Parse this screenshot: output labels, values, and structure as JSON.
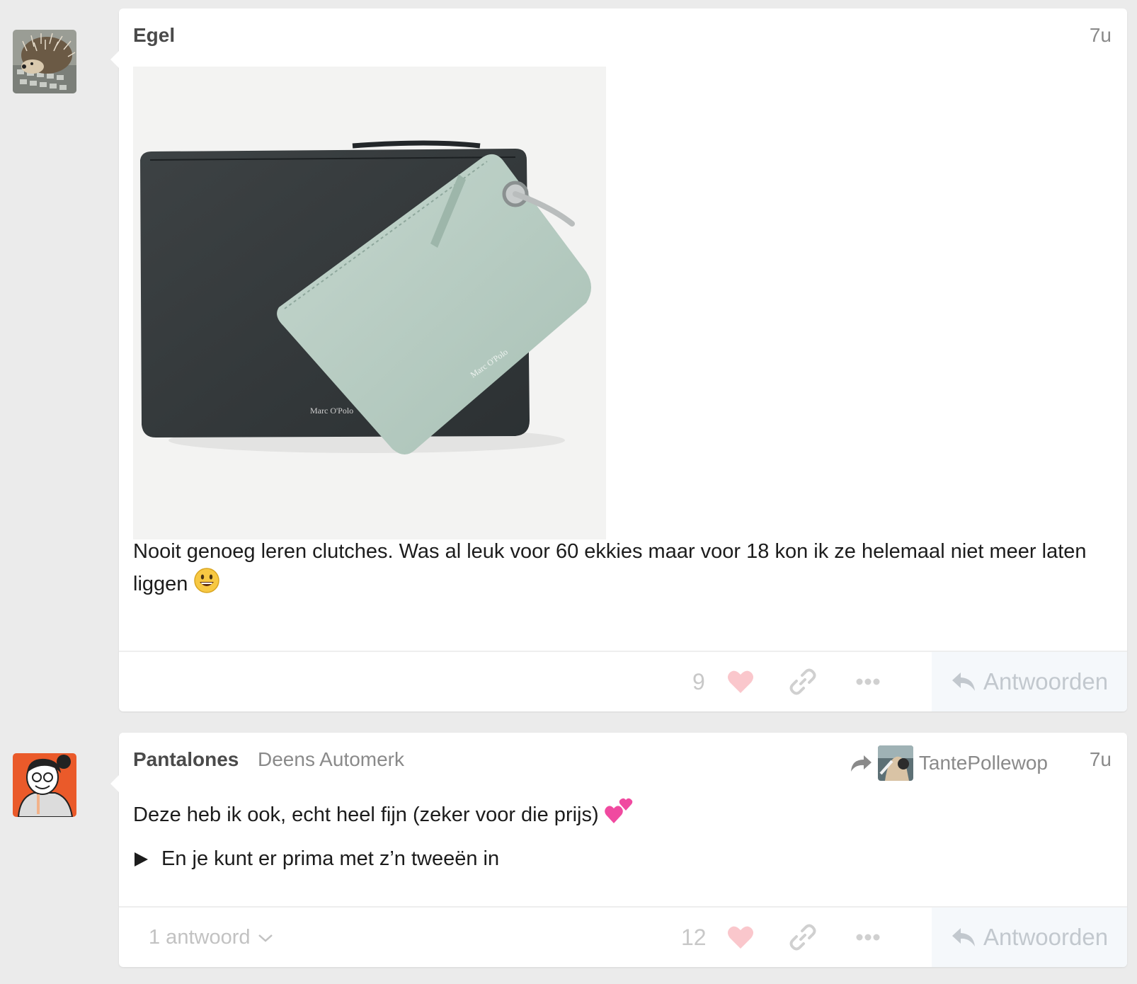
{
  "posts": [
    {
      "author": "Egel",
      "time": "7u",
      "text": "Nooit genoeg leren clutches. Was al leuk voor 60 ekkies maar voor 18 kon ik ze helemaal niet meer laten liggen",
      "emoji": "smiley-emoji",
      "image": "clutch-product-photo",
      "image_brand_text": "Marc O'Polo",
      "likes": "9",
      "reply_label": "Antwoorden"
    },
    {
      "author": "Pantalones",
      "subtitle": "Deens Automerk",
      "reply_to": "TantePollewop",
      "time": "7u",
      "text": "Deze heb ik ook, echt heel fijn (zeker voor die prijs)",
      "emoji": "two-hearts-emoji",
      "details_summary": "En je kunt er prima met z’n tweeën in",
      "replies_label": "1 antwoord",
      "likes": "12",
      "reply_label": "Antwoorden"
    }
  ],
  "colors": {
    "background": "#ebebeb",
    "heart": "#fac7cc",
    "muted_icon": "#d0d0d0",
    "reply_bg": "#f5f8fb"
  }
}
